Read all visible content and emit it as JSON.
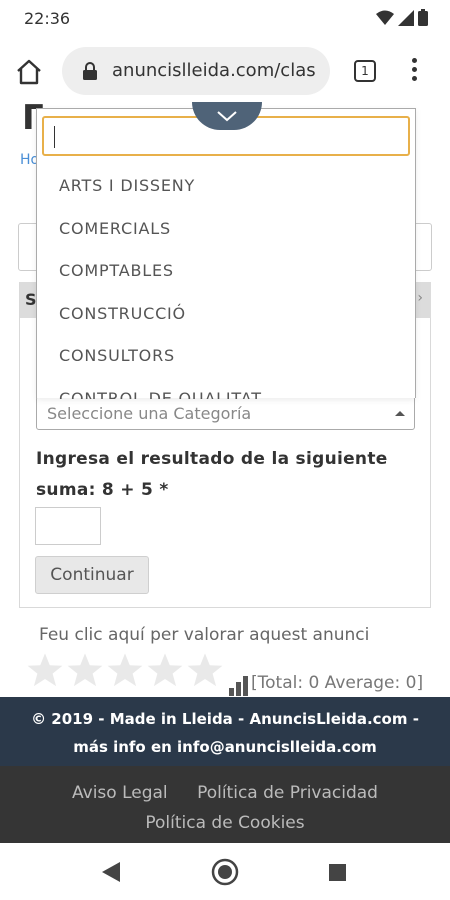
{
  "status_bar": {
    "time": "22:36"
  },
  "browser": {
    "url": "anuncislleida.com/clas",
    "tab_count": "1"
  },
  "dropdown": {
    "search_value": "",
    "options": [
      "ARTS I DISSENY",
      "COMERCIALS",
      "COMPTABLES",
      "CONSTRUCCIÓ",
      "CONSULTORS",
      "CONTROL DE QUALITAT"
    ]
  },
  "page": {
    "partial_link": "Ho",
    "partial_band": "S",
    "select_placeholder": "Seleccione una Categoría",
    "captcha_question": "Ingresa el resultado de la siguiente suma: 8 + 5 *",
    "continue_label": "Continuar",
    "rate_prompt": "Feu clic aquí per valorar aquest anunci",
    "rating": {
      "filled": 0,
      "max": 5
    },
    "rating_stats": "[Total: 0 Average: 0]"
  },
  "footer": {
    "copyright_line1": "© 2019 - Made in Lleida - AnuncisLleida.com -",
    "copyright_line2": "más info en info@anuncislleida.com",
    "links": [
      "Aviso Legal",
      "Política de Privacidad",
      "Política de Cookies"
    ]
  }
}
